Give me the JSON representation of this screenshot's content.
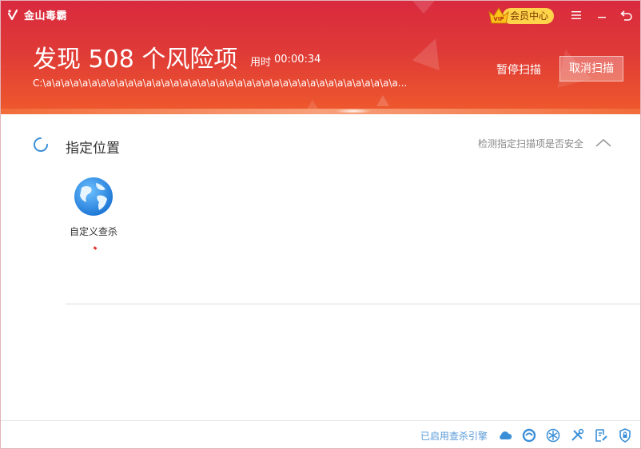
{
  "app": {
    "name": "金山毒霸"
  },
  "toolbar": {
    "vip_label": "会员中心",
    "vip_badge_text": "VIP",
    "menu_icon": "hamburger-icon",
    "minimize_icon": "minimize-icon",
    "back_icon": "back-arrow-icon"
  },
  "scan": {
    "title": "发现 508 个风险项",
    "time_label": "用时",
    "time_value": "00:00:34",
    "current_path": "C:\\a\\a\\a\\a\\a\\a\\a\\a\\a\\a\\a\\a\\a\\a\\a\\a\\a\\a\\a\\a\\a\\a\\a\\a\\a\\a\\a\\a\\a\\a\\a\\a\\a\\a\\a\\a\\a\\a\\a...",
    "pause_label": "暂停扫描",
    "cancel_label": "取消扫描"
  },
  "section": {
    "title": "指定位置",
    "note": "检测指定扫描项是否安全",
    "items": [
      {
        "label": "自定义查杀",
        "icon": "globe-icon"
      }
    ]
  },
  "footer": {
    "engine_label": "已启用查杀引擎",
    "icons": [
      "cloud-icon",
      "swirl-engine-icon",
      "snowflake-icon",
      "tools-icon",
      "document-edit-icon",
      "shield-lock-icon"
    ]
  },
  "colors": {
    "header_top": "#d92a3f",
    "header_bottom": "#ef5a2c",
    "vip_gold": "#ffd34a",
    "accent_blue": "#3a8fd8",
    "engine_link": "#5a9bd8"
  }
}
